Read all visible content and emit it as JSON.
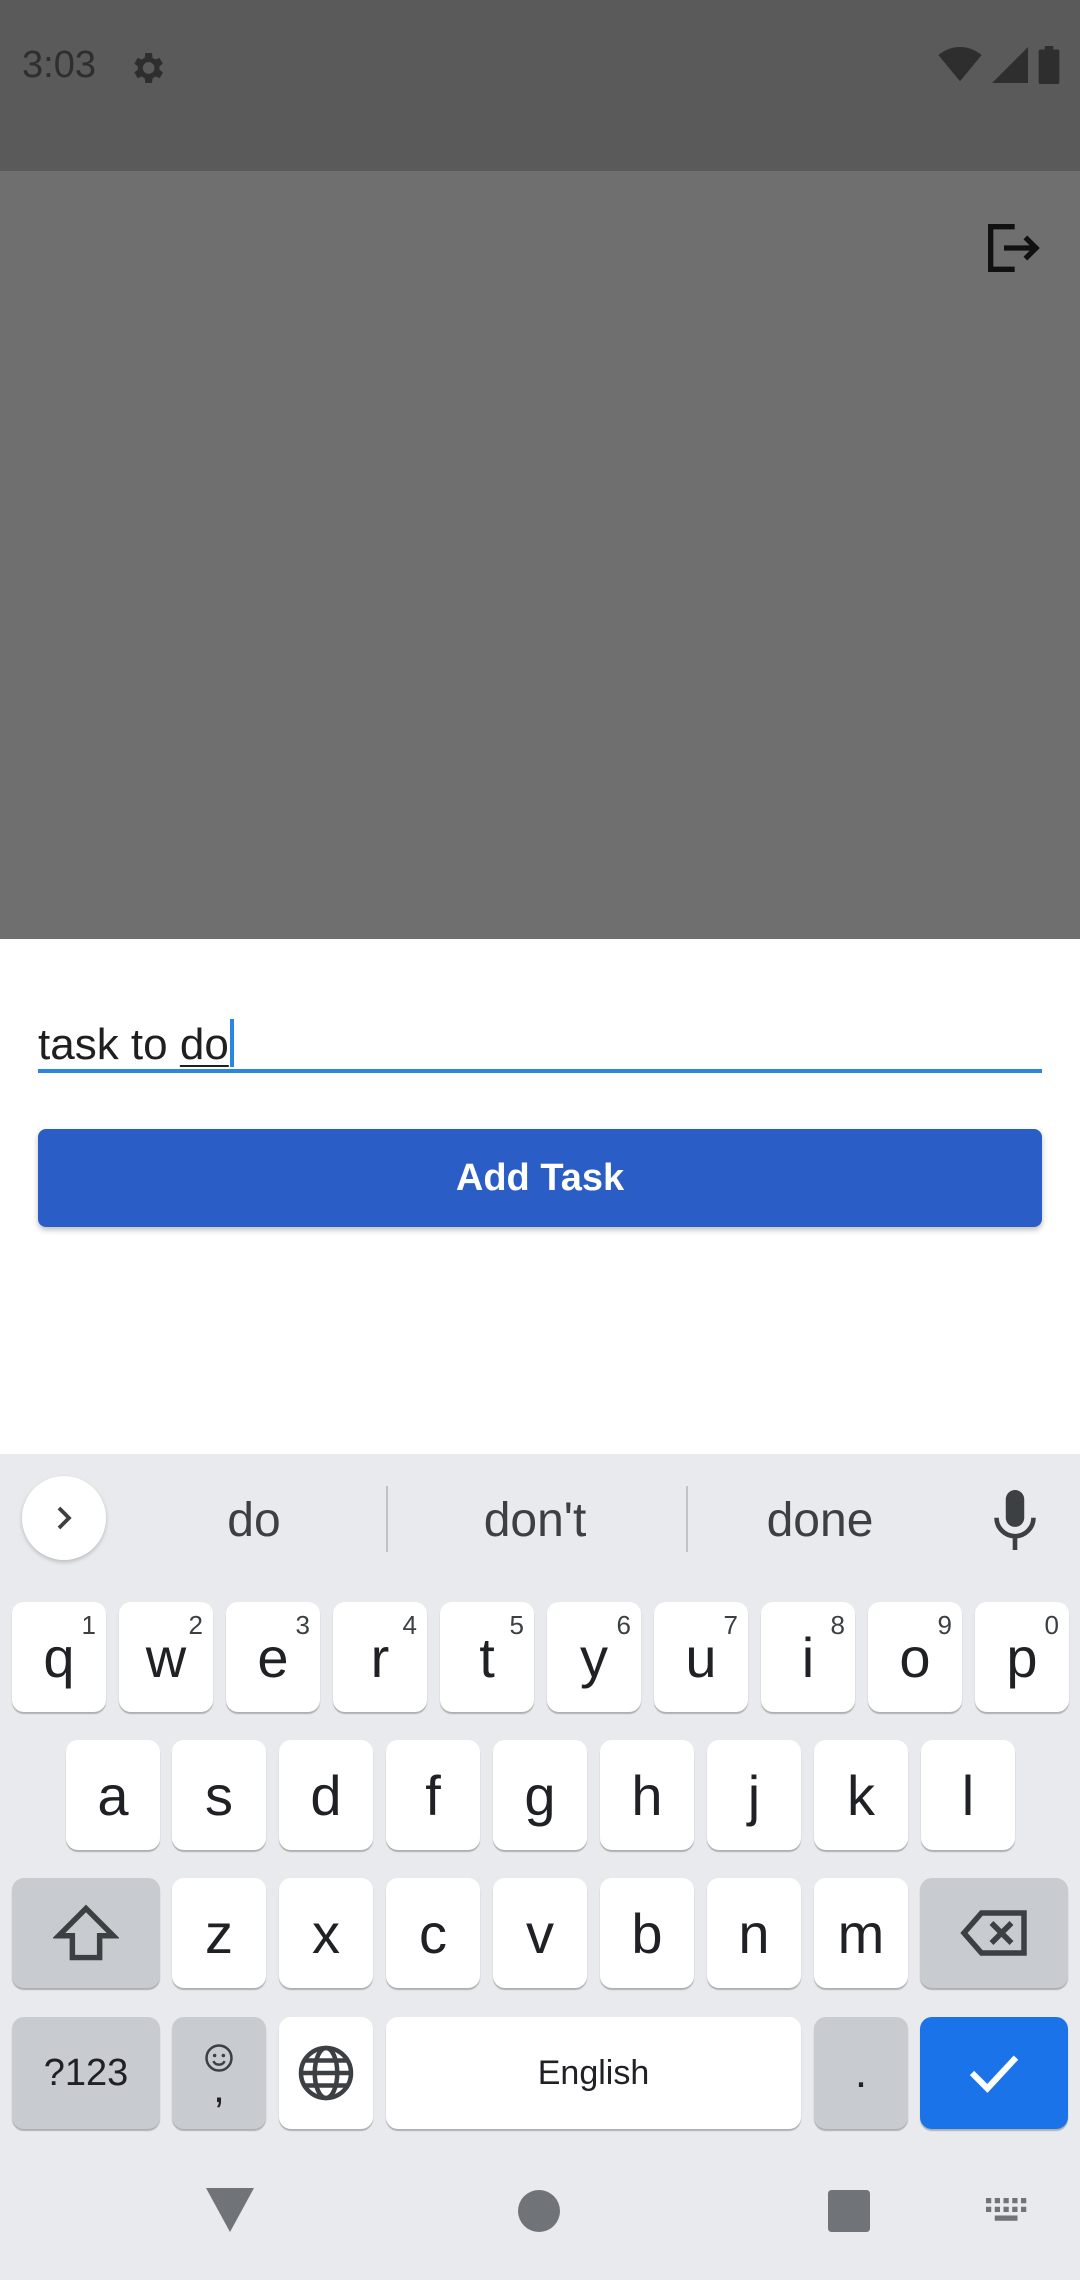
{
  "status_bar": {
    "time": "3:03"
  },
  "task_input": {
    "text_prefix": "task to ",
    "composing_word": "do"
  },
  "add_task_button": {
    "label": "Add Task"
  },
  "keyboard": {
    "suggestions": [
      "do",
      "don't",
      "done"
    ],
    "row1": [
      {
        "key": "q",
        "hint": "1"
      },
      {
        "key": "w",
        "hint": "2"
      },
      {
        "key": "e",
        "hint": "3"
      },
      {
        "key": "r",
        "hint": "4"
      },
      {
        "key": "t",
        "hint": "5"
      },
      {
        "key": "y",
        "hint": "6"
      },
      {
        "key": "u",
        "hint": "7"
      },
      {
        "key": "i",
        "hint": "8"
      },
      {
        "key": "o",
        "hint": "9"
      },
      {
        "key": "p",
        "hint": "0"
      }
    ],
    "row2": [
      "a",
      "s",
      "d",
      "f",
      "g",
      "h",
      "j",
      "k",
      "l"
    ],
    "row3": [
      "z",
      "x",
      "c",
      "v",
      "b",
      "n",
      "m"
    ],
    "symbols_label": "?123",
    "comma_label": ",",
    "space_label": "English",
    "period_label": "."
  },
  "colors": {
    "accent": "#2a86e0",
    "button": "#2a5dc6",
    "enter_key": "#1a73e8"
  }
}
